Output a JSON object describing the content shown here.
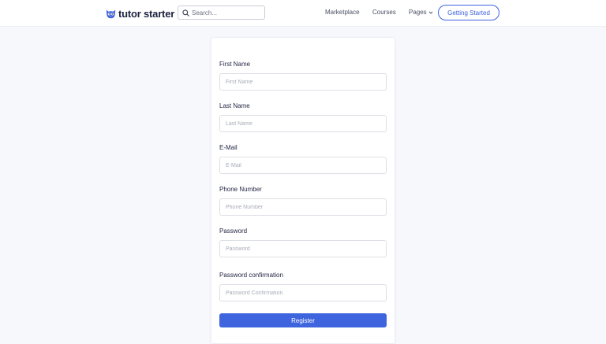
{
  "header": {
    "logo_text": "tutor starter",
    "search_placeholder": "Search...",
    "nav": {
      "marketplace": "Marketplace",
      "courses": "Courses",
      "pages": "Pages"
    },
    "cta_label": "Getting Started"
  },
  "form": {
    "first_name": {
      "label": "First Name",
      "placeholder": "First Name"
    },
    "last_name": {
      "label": "Last Name",
      "placeholder": "Last Name"
    },
    "email": {
      "label": "E-Mail",
      "placeholder": "E-Mail"
    },
    "phone": {
      "label": "Phone Number",
      "placeholder": "Phone Number"
    },
    "password": {
      "label": "Password",
      "placeholder": "Password"
    },
    "password_confirmation": {
      "label": "Password confirmation",
      "placeholder": "Password Confirmation"
    },
    "register_label": "Register"
  },
  "colors": {
    "accent": "#3e64de",
    "background": "#f7f8fc",
    "text": "#1f2340"
  },
  "icons": {
    "logo": "owl-logo-icon",
    "search": "search-icon",
    "pages_dropdown": "chevron-down-icon"
  }
}
